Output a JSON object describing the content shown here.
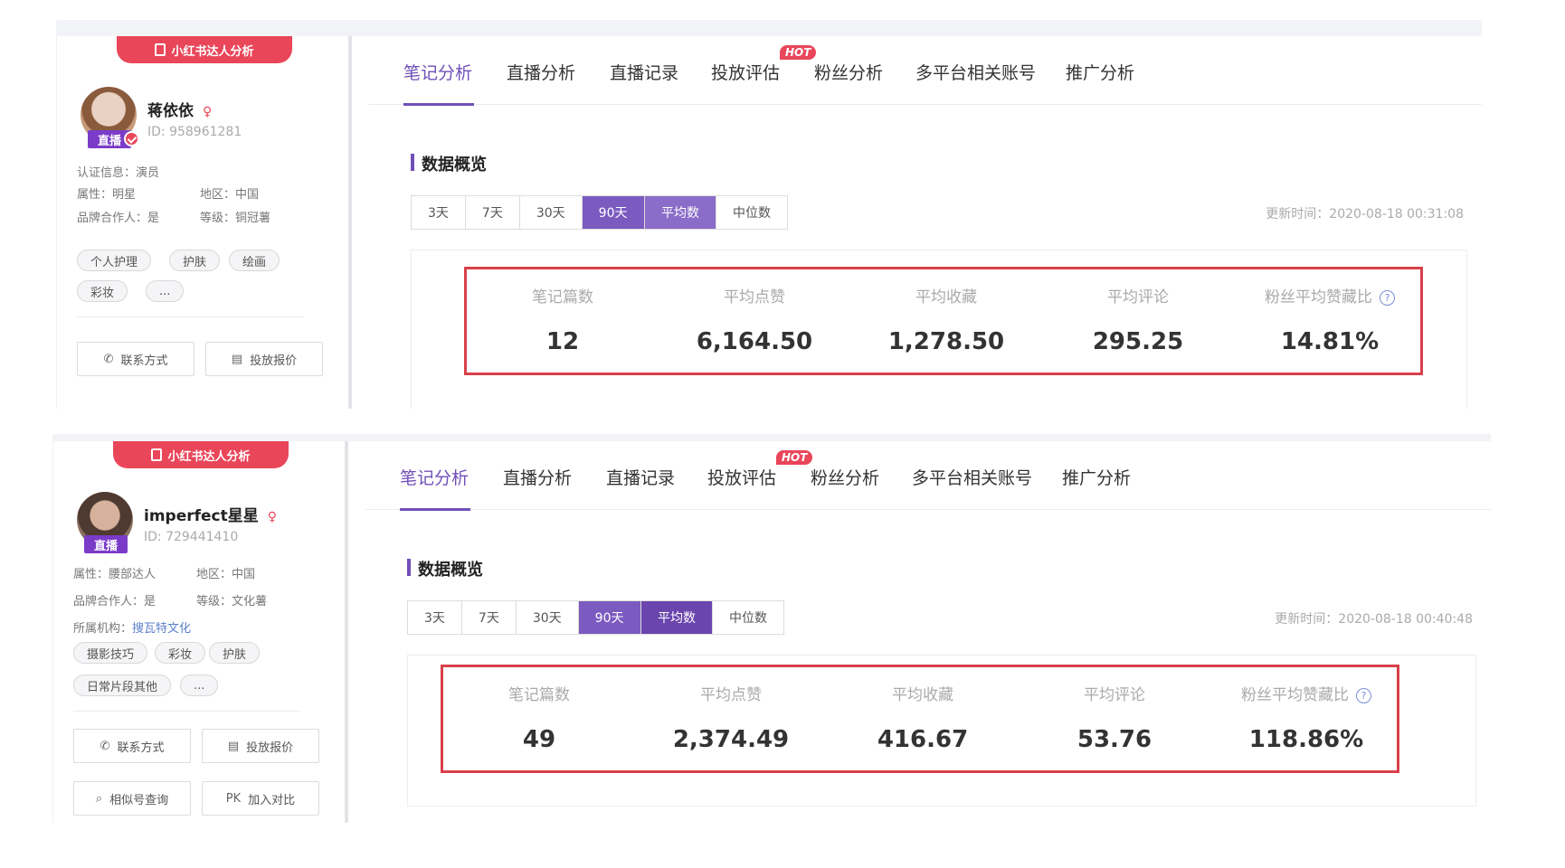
{
  "panels": [
    {
      "ribbon": "小红书达人分析",
      "profile": {
        "name": "蒋依依",
        "id": "ID: 958961281",
        "live_badge": "直播",
        "info": [
          {
            "left": "认证信息：演员",
            "right": ""
          },
          {
            "left": "属性：明星",
            "right": "地区：中国"
          },
          {
            "left": "品牌合作人：是",
            "right": "等级：铜冠薯"
          }
        ],
        "tags": [
          "个人护理",
          "护肤",
          "绘画",
          "彩妆",
          "..."
        ],
        "buttons": [
          "联系方式",
          "投放报价"
        ]
      },
      "tabs": [
        "笔记分析",
        "直播分析",
        "直播记录",
        "投放评估",
        "粉丝分析",
        "多平台相关账号",
        "推广分析"
      ],
      "hot": "HOT",
      "section_title": "数据概览",
      "range_options": [
        "3天",
        "7天",
        "30天",
        "90天"
      ],
      "stat_options": [
        "平均数",
        "中位数"
      ],
      "update_time": "更新时间：2020-08-18 00:31:08",
      "metrics": [
        {
          "label": "笔记篇数",
          "value": "12"
        },
        {
          "label": "平均点赞",
          "value": "6,164.50"
        },
        {
          "label": "平均收藏",
          "value": "1,278.50"
        },
        {
          "label": "平均评论",
          "value": "295.25"
        },
        {
          "label": "粉丝平均赞藏比",
          "value": "14.81%"
        }
      ]
    },
    {
      "ribbon": "小红书达人分析",
      "profile": {
        "name": "imperfect星星",
        "id": "ID: 729441410",
        "live_badge": "直播",
        "info": [
          {
            "left": "属性：腰部达人",
            "right": "地区：中国"
          },
          {
            "left": "品牌合作人：是",
            "right": "等级：文化薯"
          },
          {
            "left": "所属机构：",
            "link": "搜瓦特文化"
          }
        ],
        "tags": [
          "摄影技巧",
          "彩妆",
          "护肤",
          "日常片段其他",
          "..."
        ],
        "buttons": [
          "联系方式",
          "投放报价",
          "相似号查询",
          "加入对比"
        ],
        "pk_label": "PK"
      },
      "tabs": [
        "笔记分析",
        "直播分析",
        "直播记录",
        "投放评估",
        "粉丝分析",
        "多平台相关账号",
        "推广分析"
      ],
      "hot": "HOT",
      "section_title": "数据概览",
      "range_options": [
        "3天",
        "7天",
        "30天",
        "90天"
      ],
      "stat_options": [
        "平均数",
        "中位数"
      ],
      "update_time": "更新时间：2020-08-18 00:40:48",
      "metrics": [
        {
          "label": "笔记篇数",
          "value": "49"
        },
        {
          "label": "平均点赞",
          "value": "2,374.49"
        },
        {
          "label": "平均收藏",
          "value": "416.67"
        },
        {
          "label": "平均评论",
          "value": "53.76"
        },
        {
          "label": "粉丝平均赞藏比",
          "value": "118.86%"
        }
      ]
    }
  ],
  "colors": {
    "accent": "#7050b8",
    "red": "#e9465a",
    "highlight": "#d9404a"
  }
}
